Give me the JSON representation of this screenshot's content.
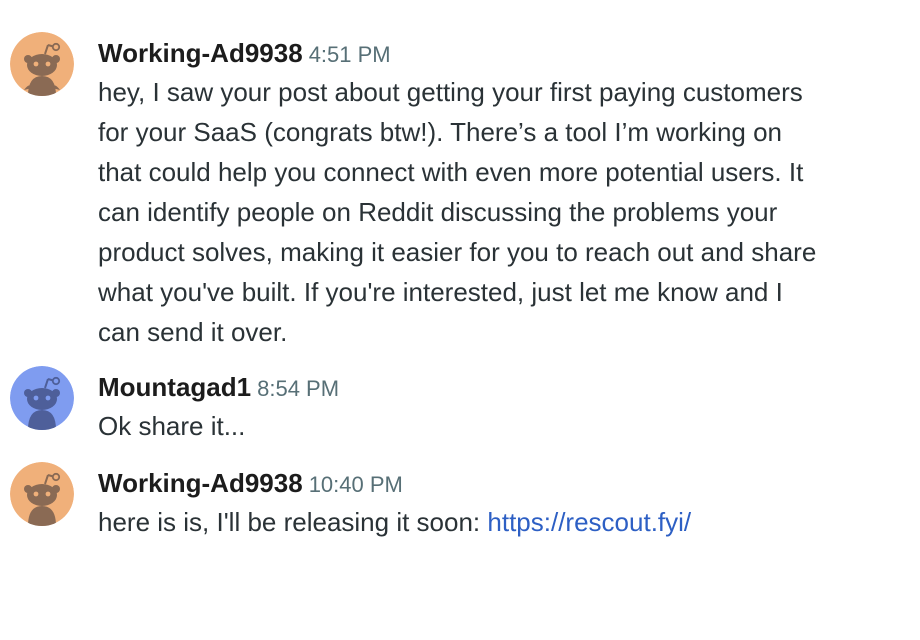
{
  "messages": [
    {
      "username": "Working-Ad9938",
      "time": "4:51 PM",
      "avatar_icon": "reddit-snoo-avatar-orange",
      "avatar_color": "#f0b07a",
      "text": "hey, I saw your post about getting your first paying customers\nfor your SaaS (congrats btw!). There’s a tool I’m working on\nthat could help you connect with even more potential users. It\ncan identify people on Reddit discussing the problems your\nproduct solves, making it easier for you to reach out and share\nwhat you've built. If you're interested, just let me know and I\ncan send it over."
    },
    {
      "username": "Mountagad1",
      "time": "8:54 PM",
      "avatar_icon": "reddit-snoo-avatar-blue",
      "avatar_color": "#7f9cf0",
      "text": "Ok share it..."
    },
    {
      "username": "Working-Ad9938",
      "time": "10:40 PM",
      "avatar_icon": "reddit-snoo-avatar-orange",
      "avatar_color": "#f0b07a",
      "text": "here is is, I'll be releasing it soon: ",
      "link": "https://rescout.fyi/"
    }
  ],
  "colors": {
    "link": "#2d5fc4",
    "timestamp": "#576f76",
    "text": "#2a3236"
  }
}
